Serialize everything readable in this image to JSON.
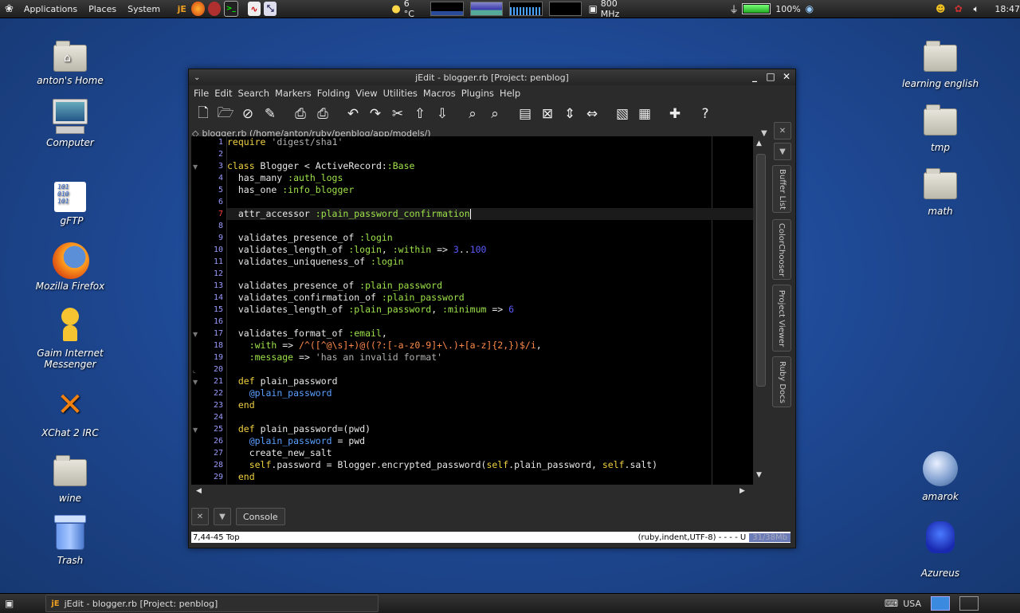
{
  "top_panel": {
    "menus": [
      "Applications",
      "Places",
      "System"
    ],
    "weather": "6 °C",
    "cpu_freq": "800 MHz",
    "battery": "100%",
    "clock": "18:47",
    "battery_level": 1.0
  },
  "desktop": {
    "left_icons": [
      "anton's Home",
      "Computer",
      "gFTP",
      "Mozilla Firefox",
      "Gaim Internet Messenger",
      "XChat 2 IRC",
      "wine",
      "Trash"
    ],
    "right_icons": [
      "learning english",
      "tmp",
      "math",
      "amarok",
      "Azureus"
    ]
  },
  "window": {
    "title": "jEdit - blogger.rb [Project: penblog]",
    "menus": [
      "File",
      "Edit",
      "Search",
      "Markers",
      "Folding",
      "View",
      "Utilities",
      "Macros",
      "Plugins",
      "Help"
    ],
    "path": "blogger.rb (/home/anton/ruby/penblog/app/models/)",
    "dock_tabs": [
      "Buffer List",
      "ColorChooser",
      "Project Viewer",
      "Ruby Docs"
    ],
    "console_label": "Console",
    "status_left": "7,44-45 Top",
    "status_right": "(ruby,indent,UTF-8) - - - - U",
    "memory": "31/38Mb"
  },
  "code": {
    "current_line": 7,
    "lines": [
      "require 'digest/sha1'",
      "",
      "class Blogger < ActiveRecord::Base",
      "  has_many :auth_logs",
      "  has_one :info_blogger",
      "",
      "  attr_accessor :plain_password_confirmation",
      "",
      "  validates_presence_of :login",
      "  validates_length_of :login, :within => 3..100",
      "  validates_uniqueness_of :login",
      "",
      "  validates_presence_of :plain_password",
      "  validates_confirmation_of :plain_password",
      "  validates_length_of :plain_password, :minimum => 6",
      "",
      "  validates_format_of :email,",
      "    :with => /^([^@\\s]+)@((?:[-a-z0-9]+\\.)+[a-z]{2,})$/i,",
      "    :message => 'has an invalid format'",
      "",
      "  def plain_password",
      "    @plain_password",
      "  end",
      "",
      "  def plain_password=(pwd)",
      "    @plain_password = pwd",
      "    create_new_salt",
      "    self.password = Blogger.encrypted_password(self.plain_password, self.salt)",
      "  end"
    ]
  },
  "bottom_panel": {
    "task": "jEdit - blogger.rb [Project: penblog]",
    "keyboard": "USA"
  }
}
